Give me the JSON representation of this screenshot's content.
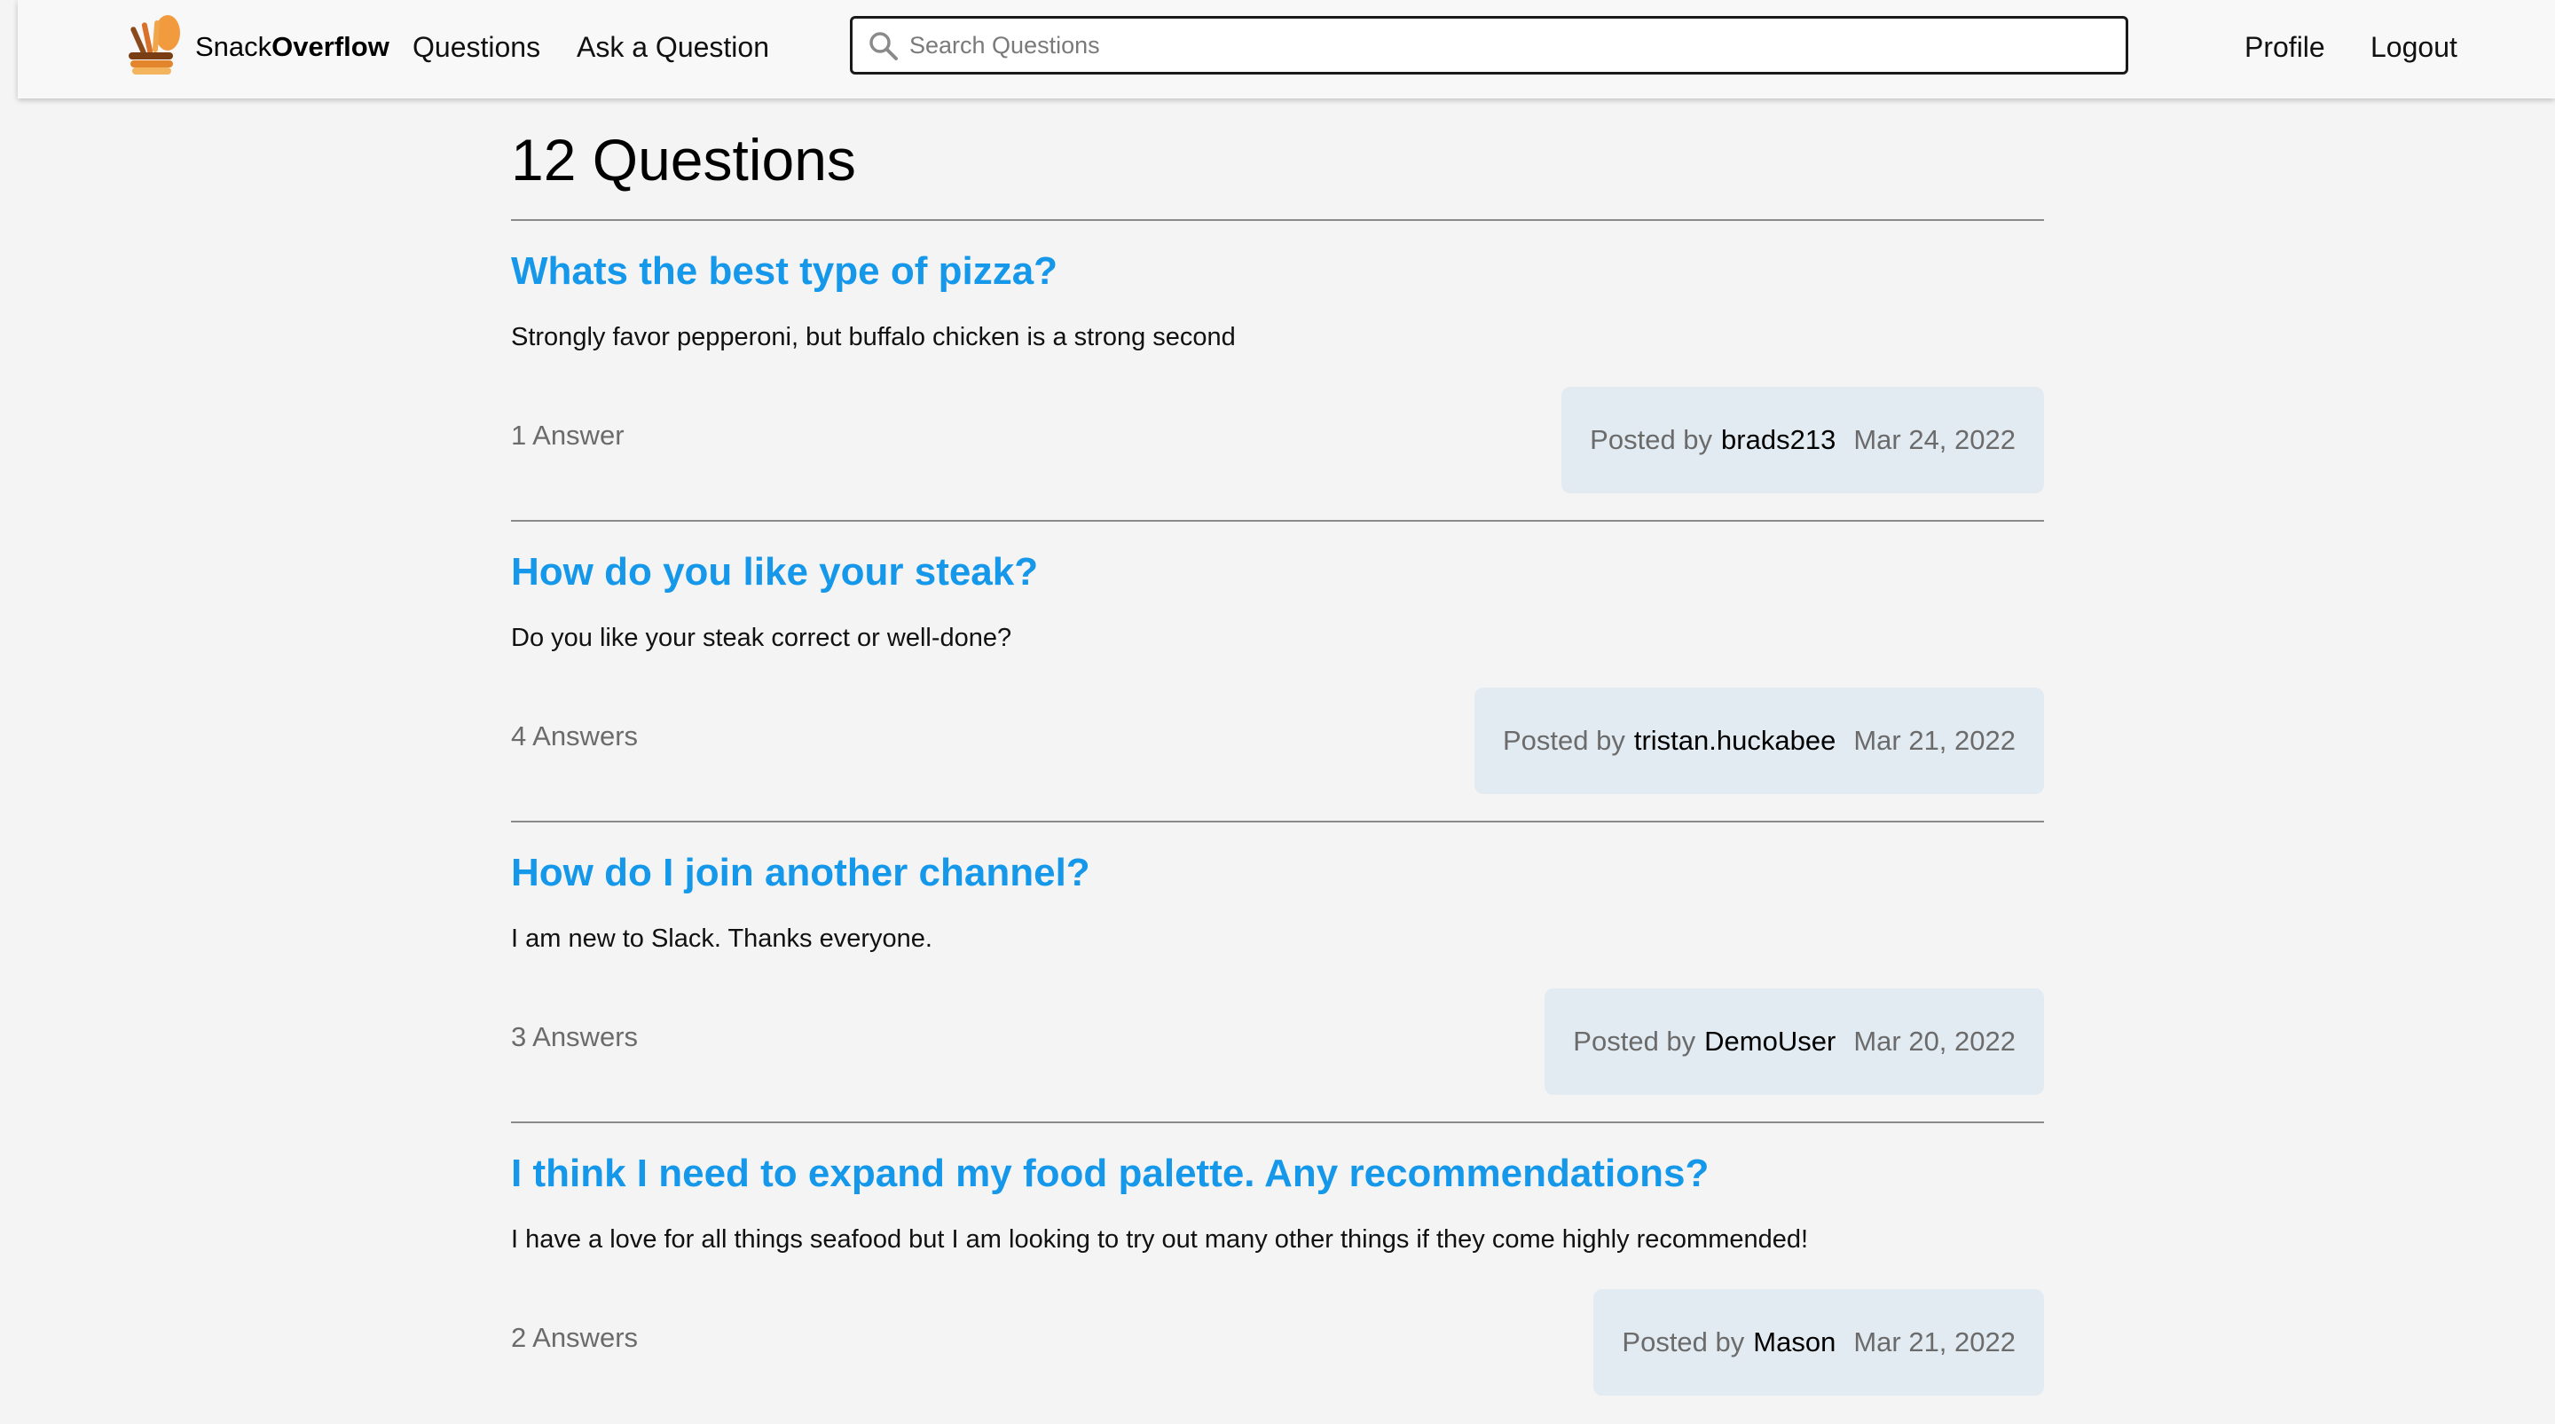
{
  "nav": {
    "brand_light": "Snack",
    "brand_bold": "Overflow",
    "questions": "Questions",
    "ask": "Ask a Question",
    "search_placeholder": "Search Questions",
    "profile": "Profile",
    "logout": "Logout"
  },
  "page": {
    "title": "12 Questions"
  },
  "questions": [
    {
      "title": "Whats the best type of pizza?",
      "body": "Strongly favor pepperoni, but buffalo chicken is a strong second",
      "answers": "1 Answer",
      "posted_by": "Posted by",
      "author": "brads213",
      "date": "Mar 24, 2022"
    },
    {
      "title": "How do you like your steak?",
      "body": "Do you like your steak correct or well-done?",
      "answers": "4 Answers",
      "posted_by": "Posted by",
      "author": "tristan.huckabee",
      "date": "Mar 21, 2022"
    },
    {
      "title": "How do I join another channel?",
      "body": "I am new to Slack. Thanks everyone.",
      "answers": "3 Answers",
      "posted_by": "Posted by",
      "author": "DemoUser",
      "date": "Mar 20, 2022"
    },
    {
      "title": "I think I need to expand my food palette. Any recommendations?",
      "body": "I have a love for all things seafood but I am looking to try out many other things if they come highly recommended!",
      "answers": "2 Answers",
      "posted_by": "Posted by",
      "author": "Mason",
      "date": "Mar 21, 2022"
    }
  ],
  "colors": {
    "link_blue": "#1597ea",
    "meta_bg": "#e2ebf2",
    "page_bg": "#f4f4f4"
  },
  "icons": {
    "logo": "snack-stack-logo-icon",
    "search": "magnifier-search-icon"
  }
}
